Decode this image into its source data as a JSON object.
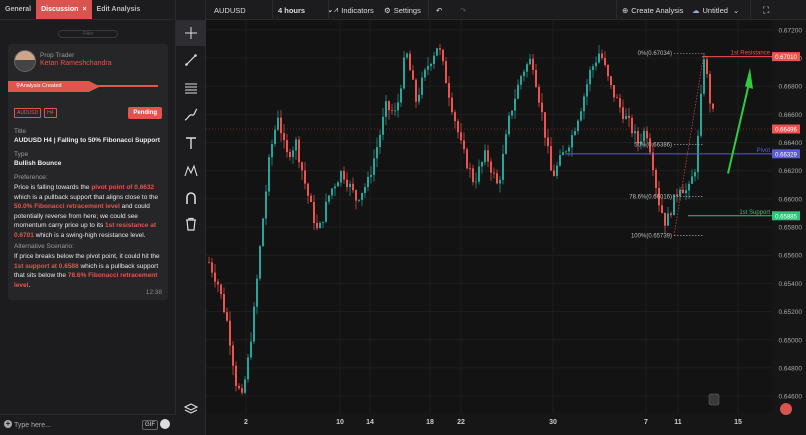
{
  "tabs": {
    "general": "General",
    "discussion": "Discussion",
    "discussion_close": "×",
    "edit": "Edit Analysis"
  },
  "filter_label": "Filter",
  "card": {
    "role": "Prop Trader",
    "name": "Ketan Rameshchandra",
    "status": "Analysis Created",
    "tags": [
      "AUDUSD",
      "H4"
    ],
    "pending": "Pending",
    "title_label": "Title",
    "title_value": "AUDUSD H4 | Falling to 50% Fibonacci Support",
    "type_label": "Type",
    "type_value": "Bullish Bounce",
    "preference_label": "Preference:",
    "preference": [
      {
        "t": "Price is falling towards the ",
        "h": false
      },
      {
        "t": "pivot point of 0.6632",
        "h": true
      },
      {
        "t": " which is a pullback support that aligns close to the ",
        "h": false
      },
      {
        "t": "50.0% Fibonacci retracement level",
        "h": true
      },
      {
        "t": " and could potentially reverse from here; we could see momentum carry price up to its ",
        "h": false
      },
      {
        "t": "1st resistance at 0.6701",
        "h": true
      },
      {
        "t": " which is a swing-high resistance level.",
        "h": false
      }
    ],
    "alternative_label": "Alternative Scenario:",
    "alternative": [
      {
        "t": "If price breaks below the pivot point, it could hit the ",
        "h": false
      },
      {
        "t": "1st support at 0.6588",
        "h": true
      },
      {
        "t": " which is a pullback support that sits below the ",
        "h": false
      },
      {
        "t": "78.6% Fibonacci retracement level",
        "h": true
      },
      {
        "t": ".",
        "h": false
      }
    ],
    "time": "12:38"
  },
  "chat": {
    "placeholder": "Type here...",
    "gif": "GIF"
  },
  "tools": [
    "crosshair-icon",
    "trendline-icon",
    "fib-lines-icon",
    "brush-icon",
    "text-icon",
    "pattern-icon",
    "magnet-icon",
    "trash-icon",
    "layers-icon"
  ],
  "topbar": {
    "symbol": "AUDUSD",
    "interval": "4 hours",
    "indicators": "Indicators",
    "settings": "Settings",
    "create_analysis": "Create Analysis",
    "layout_name": "Untitled"
  },
  "chart_data": {
    "type": "candlestick",
    "symbol": "AUDUSD",
    "interval": "4 hours",
    "ylim": [
      0.6448,
      0.6727
    ],
    "y_ticks": [
      "0.67200",
      "0.67000",
      "0.66800",
      "0.66600",
      "0.66400",
      "0.66200",
      "0.66000",
      "0.65800",
      "0.65600",
      "0.65400",
      "0.65200",
      "0.65000",
      "0.64800",
      "0.64600"
    ],
    "x_ticks": [
      "2",
      "10",
      "14",
      "18",
      "22",
      "30",
      "7",
      "11",
      "15"
    ],
    "colors": {
      "up": "#26a69a",
      "down": "#ef5350",
      "support": "#26c97a",
      "resistance": "#ef5350",
      "pivot": "#5b5bd6",
      "arrow": "#2ecc40"
    },
    "levels": [
      {
        "name": "1st Resistance",
        "value": 0.6701,
        "badge": "0.67010",
        "color": "#ef5350"
      },
      {
        "name": "Pivot",
        "value": 0.6632,
        "badge": "0.66329",
        "color": "#5b5bd6"
      },
      {
        "name": "1st Support",
        "value": 0.6588,
        "badge": "0.65885",
        "color": "#26c97a"
      }
    ],
    "price_badge": "0.66496",
    "fib": [
      {
        "label": "0%(0.67034)",
        "value": 0.67034
      },
      {
        "label": "50%(0.66386)",
        "value": 0.66386
      },
      {
        "label": "78.6%(0.66016)",
        "value": 0.66016
      },
      {
        "label": "100%(0.65739)",
        "value": 0.65739
      }
    ],
    "last_price": 0.66496
  }
}
